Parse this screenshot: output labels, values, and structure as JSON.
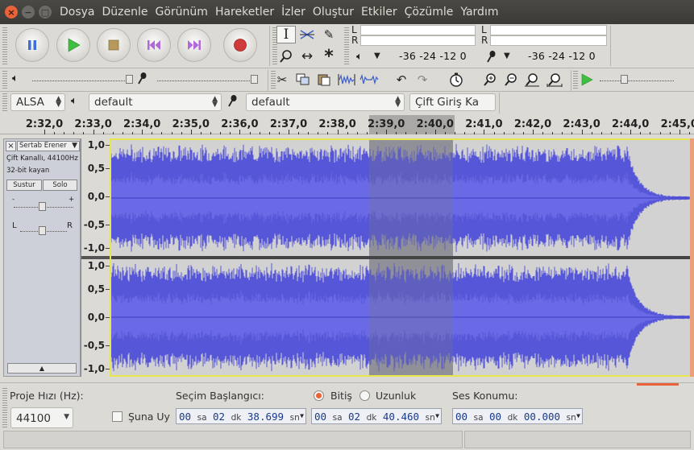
{
  "window": {
    "close": "×",
    "minimize": "−",
    "maximize": "□"
  },
  "menu": [
    "Dosya",
    "Düzenle",
    "Görünüm",
    "Hareketler",
    "İzler",
    "Oluştur",
    "Etkiler",
    "Çözümle",
    "Yardım"
  ],
  "meters": {
    "channel_l": "L",
    "channel_r": "R",
    "play_scale": "-36 -24 -12  0",
    "rec_scale": "-36 -24 -12  0"
  },
  "devices": {
    "host": "ALSA",
    "output": "default",
    "input": "default",
    "channels": "Çift Giriş Ka"
  },
  "timeline": {
    "ticks": [
      "2:32,0",
      "2:33,0",
      "2:34,0",
      "2:35,0",
      "2:36,0",
      "2:37,0",
      "2:38,0",
      "2:39,0",
      "2:40,0",
      "2:41,0",
      "2:42,0",
      "2:43,0",
      "2:44,0",
      "2:45,0"
    ]
  },
  "track": {
    "name": "Sertab Erener",
    "close": "×",
    "info1": "Çift Kanallı, 44100Hz",
    "info2": "32-bit kayan",
    "mute": "Sustur",
    "solo": "Solo",
    "gain_minus": "-",
    "gain_plus": "+",
    "pan_l": "L",
    "pan_r": "R",
    "collapse": "▲"
  },
  "vruler": {
    "labels": [
      "1,0",
      "0,5",
      "0,0",
      "-0,5",
      "-1,0"
    ]
  },
  "selection_bar": {
    "rate_label": "Proje Hızı (Hz):",
    "rate_value": "44100",
    "snap_label": "Şuna Uy",
    "start_label": "Seçim Başlangıcı:",
    "end_label": "Bitiş",
    "length_label": "Uzunluk",
    "pos_label": "Ses Konumu:",
    "start": {
      "h": "00",
      "m": "02",
      "s": "38.699"
    },
    "end": {
      "h": "00",
      "m": "02",
      "s": "40.460"
    },
    "pos": {
      "h": "00",
      "m": "00",
      "s": "00.000"
    },
    "unit_h": "sa",
    "unit_m": "dk",
    "unit_s": "sn"
  },
  "colors": {
    "wave": "#5656d8",
    "wave_dark": "#3a3ac2",
    "selection": "#9a9aa2",
    "accent": "#e8623a"
  }
}
